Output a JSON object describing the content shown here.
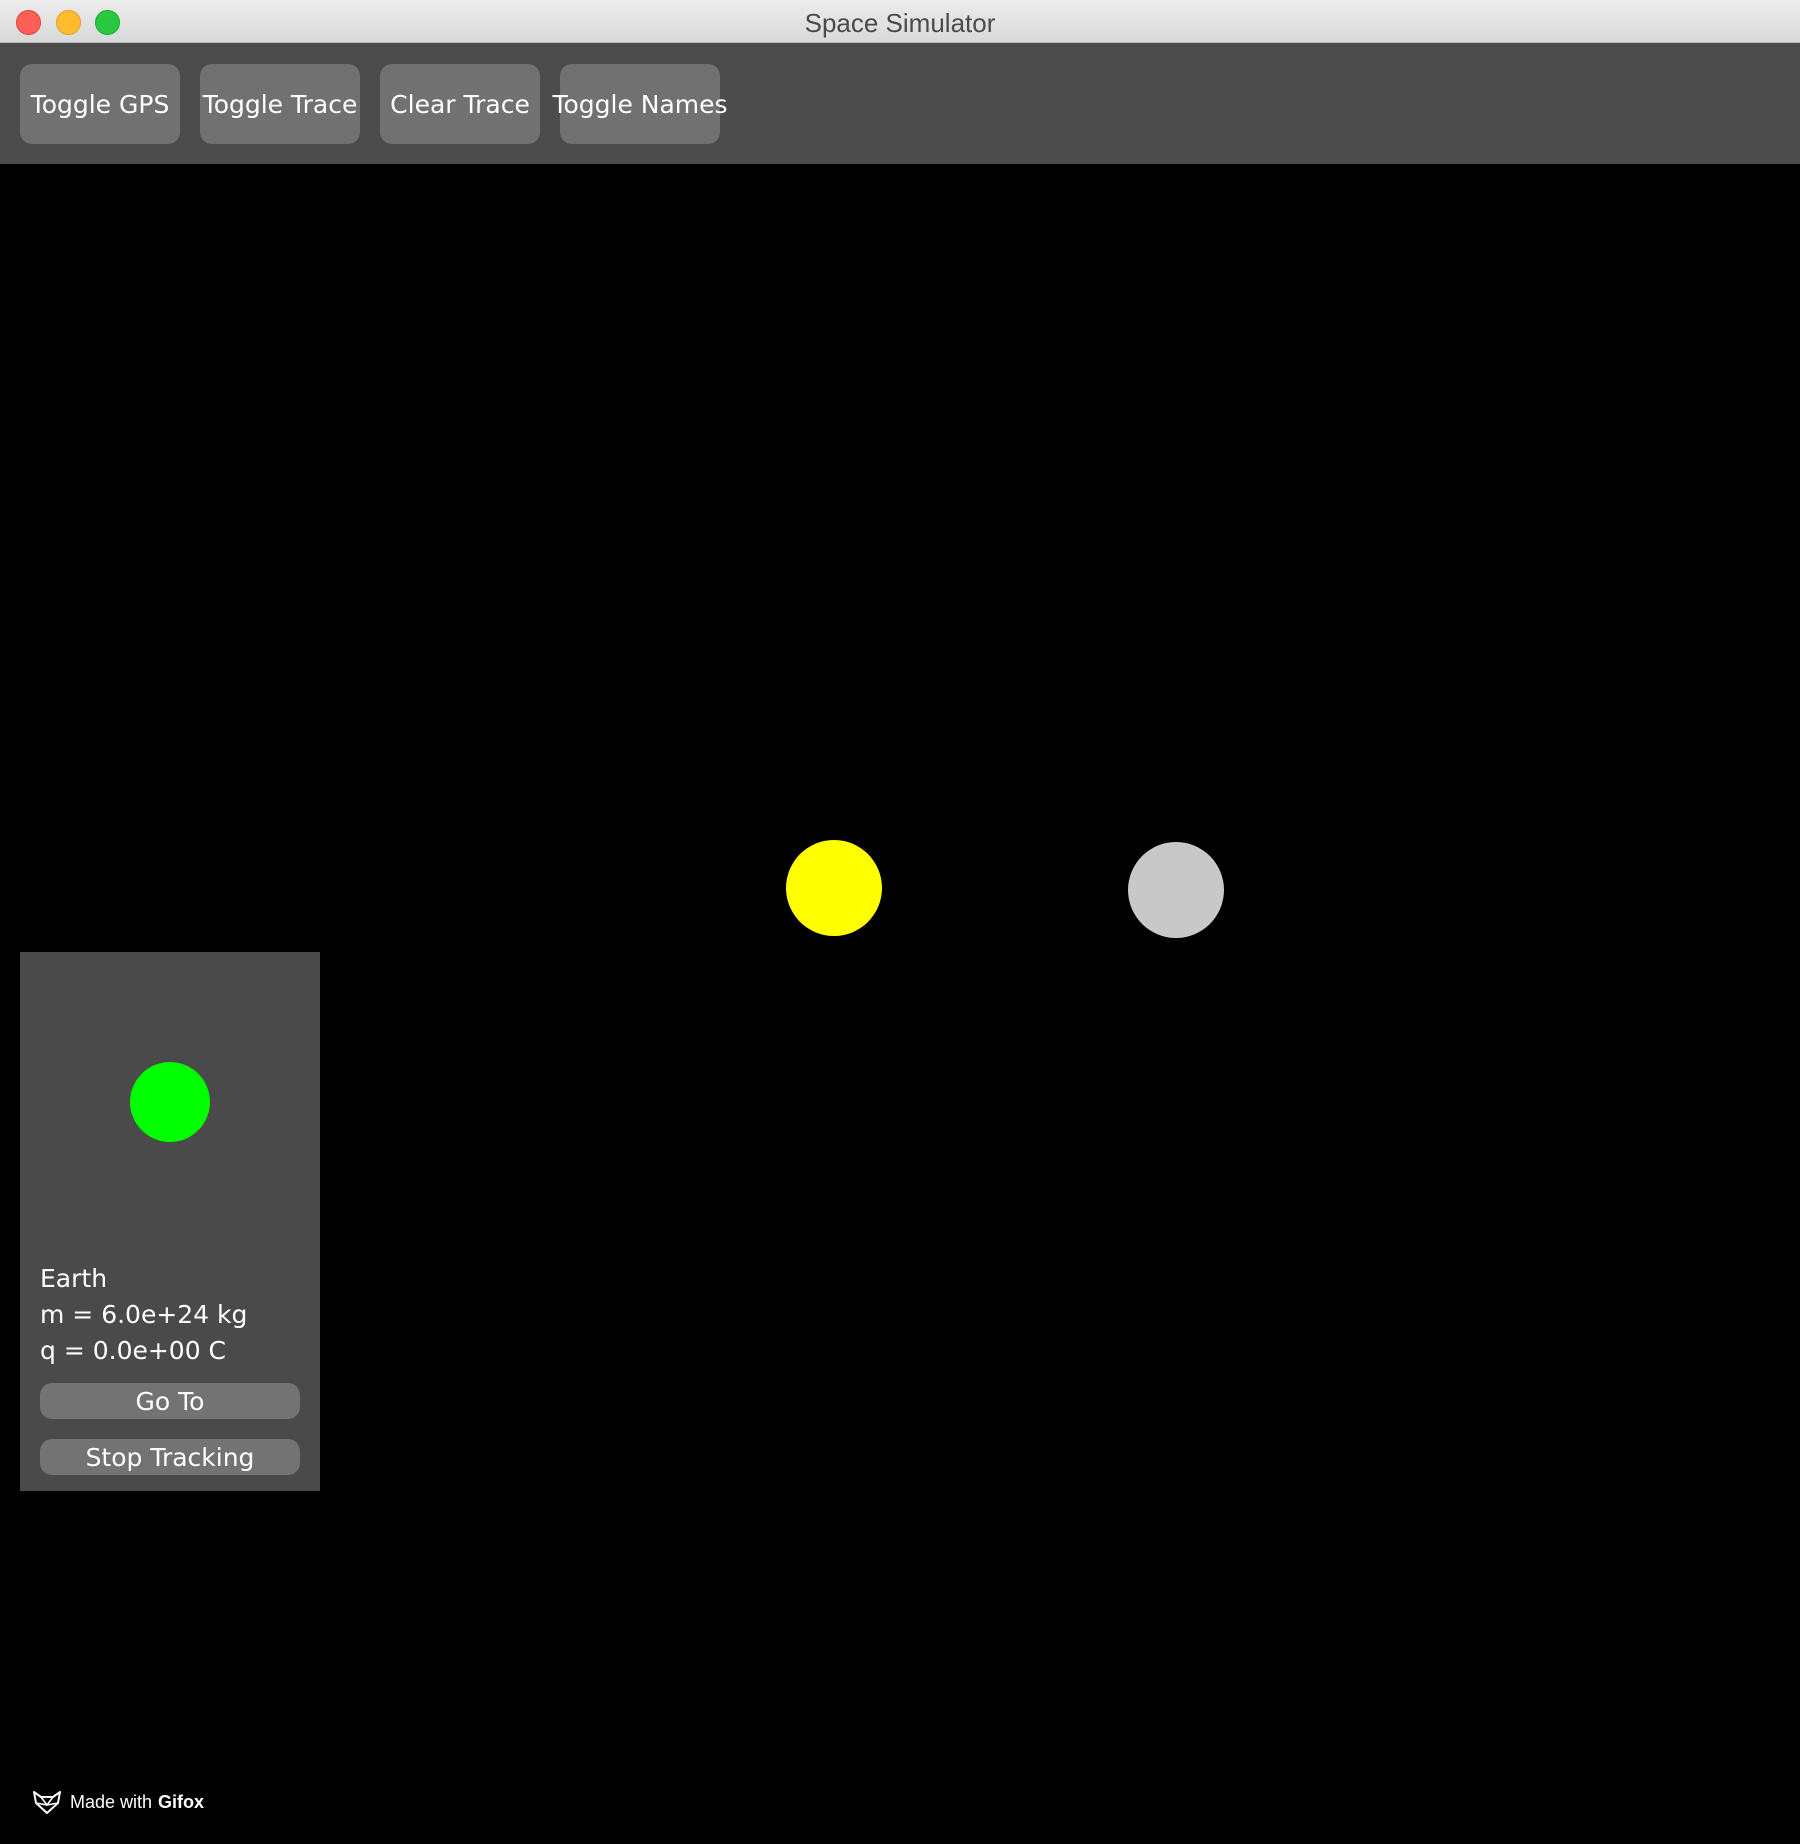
{
  "window": {
    "title": "Space Simulator"
  },
  "toolbar": {
    "buttons": [
      {
        "label": "Toggle GPS"
      },
      {
        "label": "Toggle Trace"
      },
      {
        "label": "Clear Trace"
      },
      {
        "label": "Toggle Names"
      }
    ]
  },
  "scene": {
    "background_color": "#000000",
    "bodies": [
      {
        "color": "#ffff00"
      },
      {
        "color": "#c8c8c8"
      }
    ]
  },
  "info_panel": {
    "body_color": "#00ff00",
    "name": "Earth",
    "mass": "m = 6.0e+24 kg",
    "charge": "q = 0.0e+00 C",
    "goto_label": "Go To",
    "stop_label": "Stop Tracking"
  },
  "watermark": {
    "icon": "fox-icon",
    "prefix": "Made with",
    "brand": "Gifox"
  }
}
